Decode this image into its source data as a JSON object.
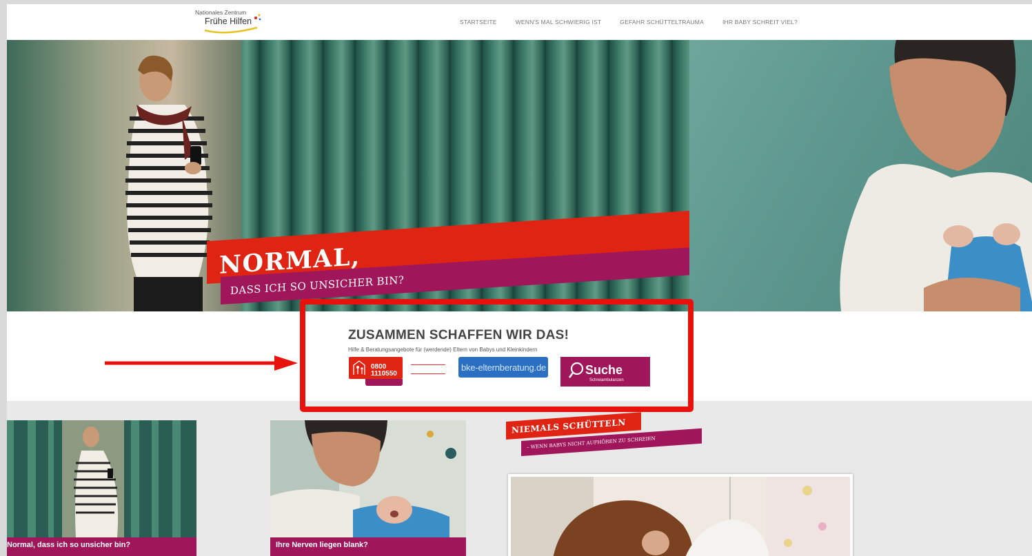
{
  "header": {
    "logo_line1": "Nationales Zentrum",
    "logo_line2": "Frühe Hilfen",
    "nav": [
      "STARTSEITE",
      "WENN'S MAL SCHWIERIG IST",
      "GEFAHR SCHÜTTELTRAUMA",
      "IHR BABY SCHREIT VIEL?"
    ]
  },
  "hero": {
    "headline": "NORMAL,",
    "subline": "DASS ICH SO UNSICHER BIN?"
  },
  "help": {
    "title": "ZUSAMMEN SCHAFFEN WIR DAS!",
    "subtitle": "Hilfe & Beratungsangebote für (werdende) Eltern von Babys und Kleinkindern",
    "elterntelefon": {
      "number_line1": "0800",
      "number_line2": "1110550"
    },
    "bke": {
      "main": "bke-elternberatung.de"
    },
    "suche": {
      "main": "Suche",
      "sub": "Schreiambulanzen"
    }
  },
  "cards": [
    {
      "title": "Normal, dass ich so unsicher bin?"
    },
    {
      "title": "Ihre Nerven liegen blank?"
    }
  ],
  "campaign": {
    "headline": "NIEMALS SCHÜTTELN",
    "subline": "– WENN BABYS NICHT AUFHÖREN ZU SCHREIEN"
  },
  "colors": {
    "red": "#e02414",
    "magenta": "#a0165a",
    "annotation_red": "#e8120c"
  }
}
